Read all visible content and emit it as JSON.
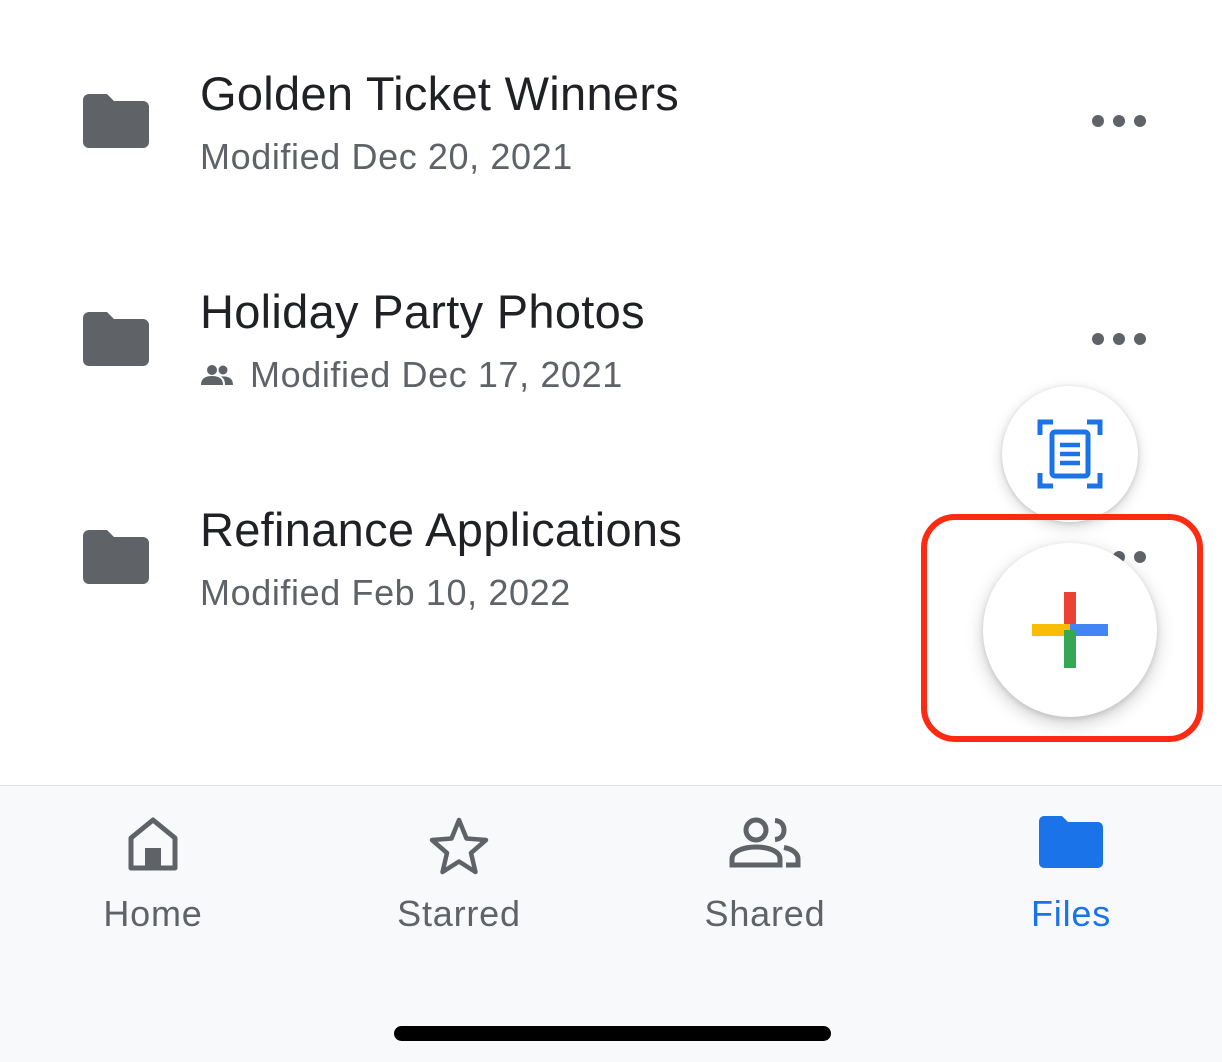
{
  "files": [
    {
      "name": "Golden Ticket Winners",
      "modified": "Modified Dec 20, 2021",
      "shared": false
    },
    {
      "name": "Holiday Party Photos",
      "modified": "Modified Dec 17, 2021",
      "shared": true
    },
    {
      "name": "Refinance Applications",
      "modified": "Modified Feb 10, 2022",
      "shared": false
    }
  ],
  "fab": {
    "scan_icon": "document-scan-icon",
    "new_icon": "plus-multicolor-icon"
  },
  "bottom_nav": {
    "items": [
      {
        "label": "Home",
        "icon": "home-icon",
        "active": false
      },
      {
        "label": "Starred",
        "icon": "star-icon",
        "active": false
      },
      {
        "label": "Shared",
        "icon": "people-icon",
        "active": false
      },
      {
        "label": "Files",
        "icon": "folder-icon",
        "active": true
      }
    ]
  },
  "colors": {
    "folder": "#5f6368",
    "text_primary": "#202124",
    "text_secondary": "#5f6368",
    "accent": "#1a73e8",
    "highlight": "#ff2a12",
    "google_red": "#ea4335",
    "google_blue": "#4285f4",
    "google_yellow": "#fbbc04",
    "google_green": "#34a853"
  }
}
